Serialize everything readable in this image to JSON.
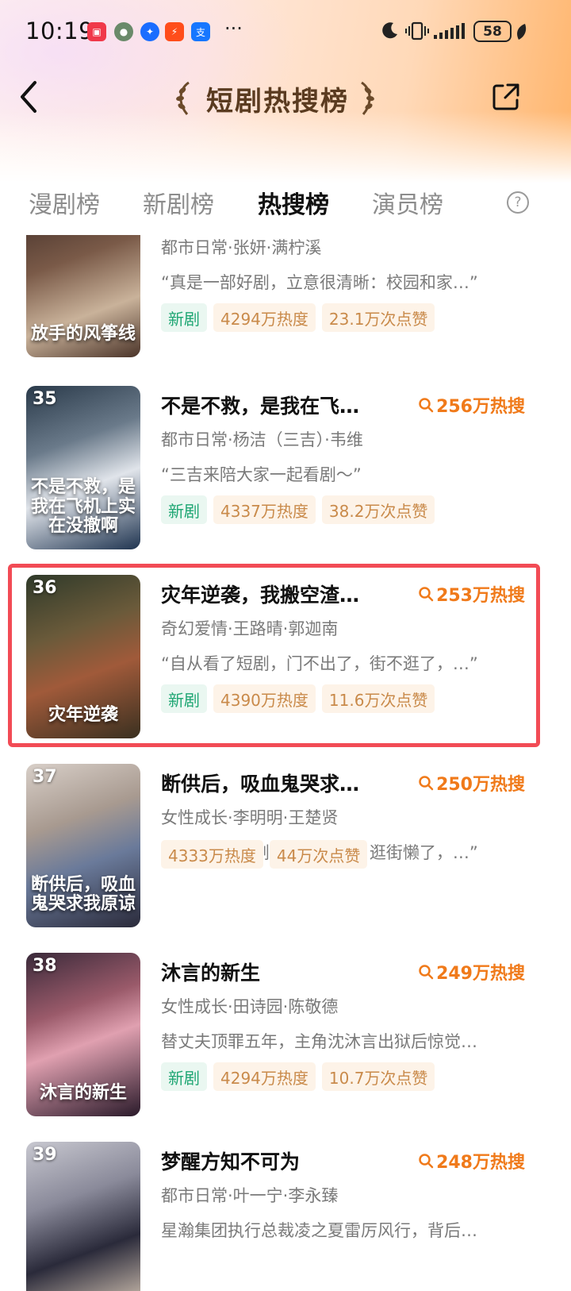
{
  "status_bar": {
    "time": "10:19",
    "battery": "58"
  },
  "nav": {
    "title": "短剧热搜榜"
  },
  "tabs": [
    "漫剧榜",
    "新剧榜",
    "热搜榜",
    "演员榜"
  ],
  "help_label": "?",
  "colors": {
    "accent": "#f07a1a",
    "highlight": "#f24b55",
    "tag_green": "#1ea673",
    "tag_orange": "#c98a4a"
  },
  "items": [
    {
      "rank": "",
      "title": "",
      "hot": "",
      "meta": "都市日常·张妍·满柠溪",
      "quote": "“真是一部好剧，立意很清晰：校园和家…”",
      "tags": [
        "新剧",
        "4294万热度",
        "23.1万次点赞"
      ],
      "cover_text": "放手的风筝线"
    },
    {
      "rank": "35",
      "title": "不是不救，是我在飞…",
      "hot": "256万热搜",
      "meta": "都市日常·杨洁（三吉）·韦维",
      "quote": "“三吉来陪大家一起看剧～”",
      "tags": [
        "新剧",
        "4337万热度",
        "38.2万次点赞"
      ],
      "cover_text": "不是不救，是我在飞机上实在没撤啊"
    },
    {
      "rank": "36",
      "title": "灾年逆袭，我搬空渣…",
      "hot": "253万热搜",
      "meta": "奇幻爱情·王路晴·郭迦南",
      "quote": "“自从看了短剧，门不出了，街不逛了，…”",
      "tags": [
        "新剧",
        "4390万热度",
        "11.6万次点赞"
      ],
      "cover_text": "灾年逆袭"
    },
    {
      "rank": "37",
      "title": "断供后，吸血鬼哭求…",
      "hot": "250万热搜",
      "meta": "女性成长·李明明·王楚贤",
      "quote": "“自从迷上短剧，综艺戒了，逛街懒了，…”",
      "tags": [
        "4333万热度",
        "44万次点赞"
      ],
      "cover_text": "断供后，吸血鬼哭求我原谅"
    },
    {
      "rank": "38",
      "title": "沐言的新生",
      "hot": "249万热搜",
      "meta": "女性成长·田诗园·陈敬德",
      "quote": "替丈夫顶罪五年，主角沈沐言出狱后惊觉…",
      "tags": [
        "新剧",
        "4294万热度",
        "10.7万次点赞"
      ],
      "cover_text": "沐言的新生"
    },
    {
      "rank": "39",
      "title": "梦醒方知不可为",
      "hot": "248万热搜",
      "meta": "都市日常·叶一宁·李永臻",
      "quote": "星瀚集团执行总裁凌之夏雷厉风行，背后…",
      "tags": [],
      "cover_text": ""
    }
  ]
}
